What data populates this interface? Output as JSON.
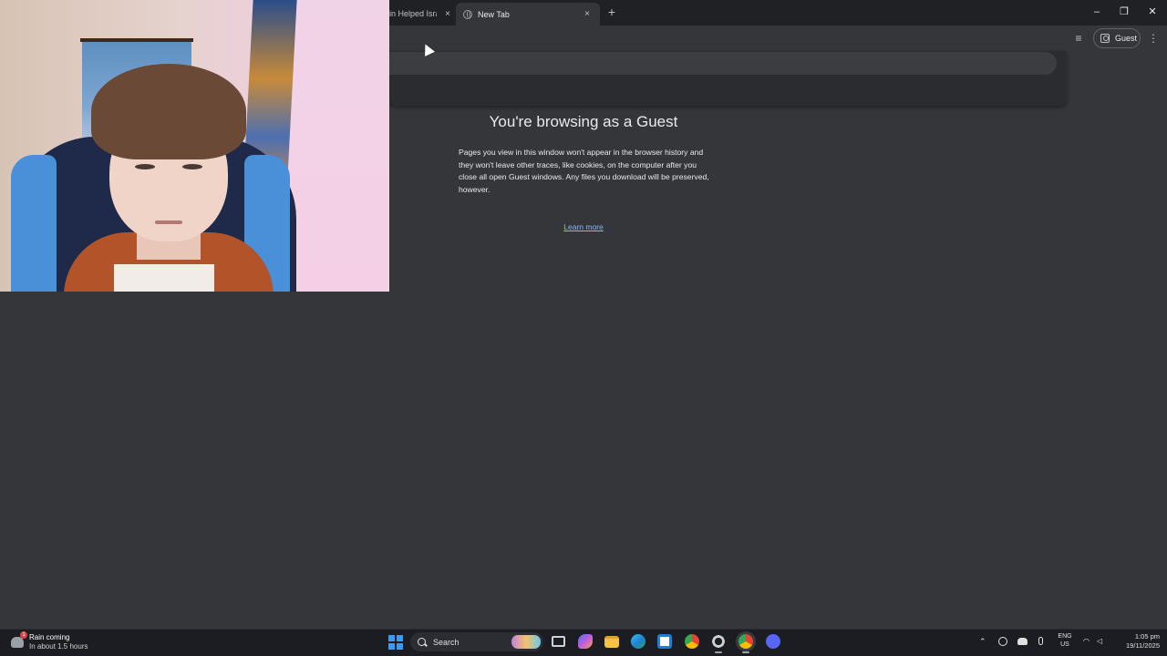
{
  "browser": {
    "tabs": [
      {
        "title": "in Helped Isra",
        "close": "×",
        "active": false
      },
      {
        "title": "New Tab",
        "close": "×",
        "active": true
      }
    ],
    "new_tab": "+",
    "window_controls": {
      "minimize": "–",
      "maximize": "❐",
      "close": "✕"
    },
    "profile_label": "Guest",
    "menu_icon": "⋮",
    "tab_search_icon": "≡",
    "omnibox": {
      "value": "",
      "placeholder": ""
    }
  },
  "page": {
    "title": "You're browsing as a Guest",
    "description": "Pages you view in this window won't appear in the browser history and they won't leave other traces, like cookies, on the computer after you close all open Guest windows. Any files you download will be preserved, however.",
    "learn_more": "Learn more"
  },
  "taskbar": {
    "weather": {
      "title": "Rain coming",
      "subtitle": "In about 1.5 hours",
      "badge": "1"
    },
    "search_label": "Search",
    "apps": [
      "task-view",
      "copilot",
      "file-explorer",
      "edge",
      "microsoft-store",
      "chrome",
      "obs",
      "chrome-guest",
      "discord"
    ],
    "tray": {
      "lang": "ENG",
      "region": "US",
      "time": "1:05 pm",
      "date": "19/11/2025"
    }
  },
  "colors": {
    "page_bg": "#35363a",
    "tabbar_bg": "#202124",
    "link": "#8ab4f8",
    "taskbar_bg": "#1c1d22",
    "start_blue": "#3b9af3"
  }
}
